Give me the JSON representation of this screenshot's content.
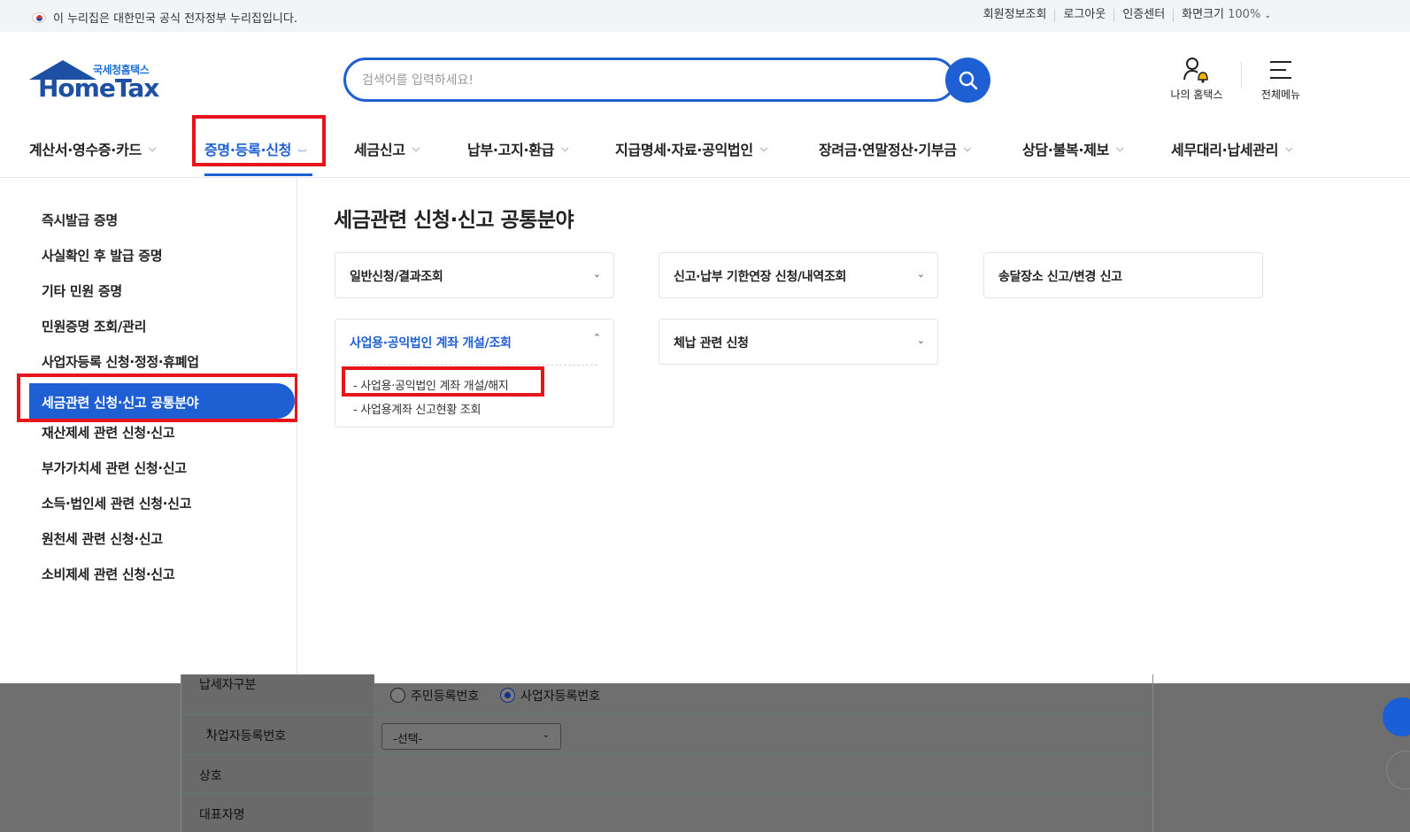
{
  "topbar": {
    "notice": "이 누리집은 대한민국 공식 전자정부 누리집입니다.",
    "links": [
      "회원정보조회",
      "로그아웃",
      "인증센터",
      "화면크기"
    ],
    "zoom": "100%"
  },
  "logo": {
    "sub": "국세청홈택스",
    "main": "HomeTax"
  },
  "search": {
    "placeholder": "검색어를 입력하세요!"
  },
  "utility": {
    "my": "나의 홈택스",
    "menu": "전체메뉴"
  },
  "gnb": [
    "계산서·영수증·카드",
    "증명·등록·신청",
    "세금신고",
    "납부·고지·환급",
    "지급명세·자료·공익법인",
    "장려금·연말정산·기부금",
    "상담·불복·제보",
    "세무대리·납세관리"
  ],
  "sidebar": [
    "즉시발급 증명",
    "사실확인 후 발급 증명",
    "기타 민원 증명",
    "민원증명 조회/관리",
    "사업자등록 신청·정정·휴폐업",
    "세금관련 신청·신고 공통분야",
    "재산제세 관련 신청·신고",
    "부가가치세 관련 신청·신고",
    "소득·법인세 관련 신청·신고",
    "원천세 관련 신청·신고",
    "소비제세 관련 신청·신고"
  ],
  "content": {
    "title": "세금관련 신청·신고 공통분야",
    "cards": [
      "일반신청/결과조회",
      "신고·납부 기한연장 신청/내역조회",
      "송달장소 신고/변경 신고",
      "사업용·공익법인 계좌 개설/조회",
      "체납 관련 신청"
    ],
    "sub_items": [
      "사업용·공익법인 계좌 개설/해지",
      "사업용계좌 신고현황 조회"
    ]
  },
  "form": {
    "taxpayer_type_label": "납세자구분",
    "radio_options": [
      "주민등록번호",
      "사업자등록번호"
    ],
    "bizno_label": "사업자등록번호",
    "select_value": "-선택-",
    "name_label": "상호",
    "rep_label": "대표자명"
  }
}
